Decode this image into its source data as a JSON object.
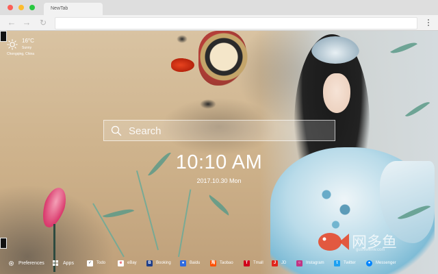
{
  "window": {
    "tab_title": "NewTab"
  },
  "weather": {
    "temperature": "16°C",
    "condition": "Sunny",
    "location": "Chongqing, China",
    "icon": "sun-icon"
  },
  "search": {
    "placeholder": "Search",
    "icon": "search-icon"
  },
  "clock": {
    "time": "10:10 AM",
    "date": "2017.10.30 Mon"
  },
  "watermark": {
    "text": "网多鱼",
    "url": "gushiwenw.com"
  },
  "bottom_bar": {
    "preferences": "Preferences",
    "apps": "Apps",
    "links": [
      {
        "label": "Todo",
        "icon": "checkbox-icon",
        "color": "#ffffff"
      },
      {
        "label": "eBay",
        "icon": "ebay-icon",
        "color": "#ffffff"
      },
      {
        "label": "Booking",
        "icon": "booking-icon",
        "color": "#1f3f8a"
      },
      {
        "label": "Baidu",
        "icon": "baidu-icon",
        "color": "#2e6ae0"
      },
      {
        "label": "Taobao",
        "icon": "taobao-icon",
        "color": "#ff5000"
      },
      {
        "label": "Tmall",
        "icon": "tmall-icon",
        "color": "#d0021b"
      },
      {
        "label": "JD",
        "icon": "jd-icon",
        "color": "#e1251b"
      },
      {
        "label": "Instagram",
        "icon": "instagram-icon",
        "color": "#c13584"
      },
      {
        "label": "Twitter",
        "icon": "twitter-icon",
        "color": "#1da1f2"
      },
      {
        "label": "Messenger",
        "icon": "messenger-icon",
        "color": "#0084ff"
      }
    ]
  }
}
